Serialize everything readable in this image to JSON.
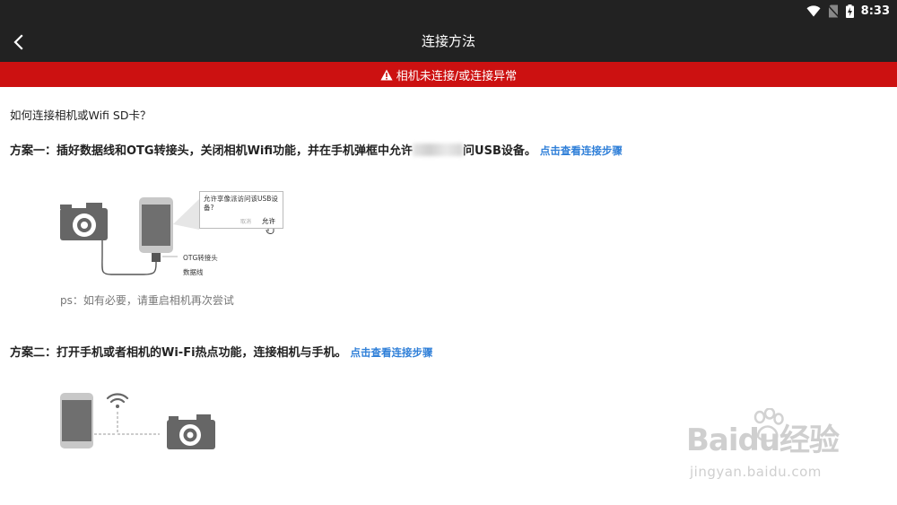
{
  "status_bar": {
    "time": "8:33"
  },
  "header": {
    "title": "连接方法"
  },
  "alert": {
    "text": "相机未连接/或连接异常",
    "color": "#cc1111"
  },
  "question": "如何连接相机或Wifi SD卡？",
  "plan1": {
    "text_before": "方案一：插好数据线和OTG转接头，关闭相机Wifi功能，并在手机弹框中允许",
    "text_after": "问USB设备。",
    "link": "点击查看连接步骤",
    "dialog_message": "允许享像派访问该USB设备?",
    "dialog_cancel": "取消",
    "dialog_allow": "允许",
    "otg_label": "OTG转接头",
    "cable_label": "数据线",
    "note": "ps：如有必要，请重启相机再次尝试"
  },
  "plan2": {
    "text": "方案二：打开手机或者相机的Wi-Fi热点功能，连接相机与手机。",
    "link": "点击查看连接步骤"
  },
  "watermark": {
    "logo": "Baidu经验",
    "url": "jingyan.baidu.com"
  },
  "colors": {
    "bar": "#222222",
    "accent": "#cc1111",
    "link": "#2f7fd8"
  }
}
